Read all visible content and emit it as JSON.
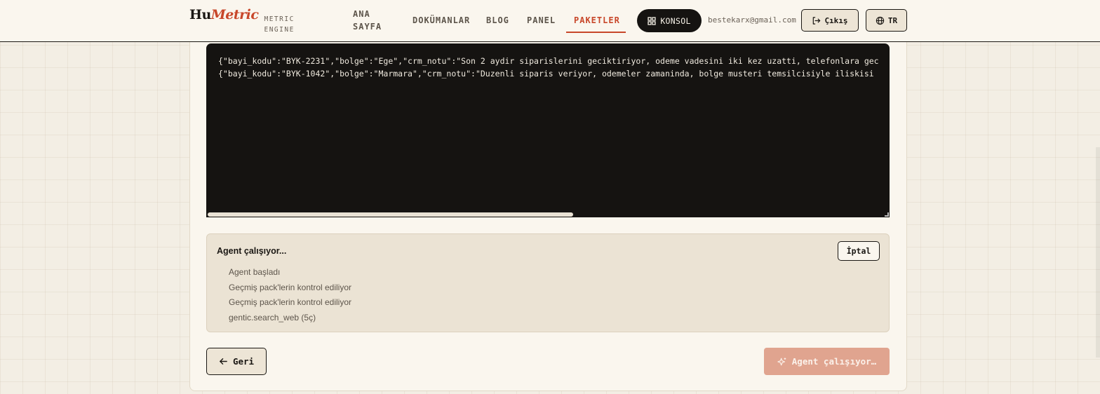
{
  "header": {
    "logo": {
      "part1": "Hu",
      "part2": "Metric",
      "subtitle_line1": "METRIC",
      "subtitle_line2": "ENGINE"
    },
    "nav": [
      {
        "label_line1": "ANA",
        "label_line2": "SAYFA"
      },
      {
        "label": "DOKÜMANLAR"
      },
      {
        "label": "BLOG"
      },
      {
        "label": "PANEL"
      },
      {
        "label": "PAKETLER",
        "active": true
      }
    ],
    "console_label": "KONSOL",
    "user_email": "bestekarx@gmail.com",
    "logout_label": "Çıkış",
    "language_label": "TR"
  },
  "editor": {
    "lines": [
      "{\"bayi_kodu\":\"BYK-2231\",\"bolge\":\"Ege\",\"crm_notu\":\"Son 2 aydir siparislerini geciktiriyor, odeme vadesini iki kez uzatti, telefonlara gec",
      "{\"bayi_kodu\":\"BYK-1042\",\"bolge\":\"Marmara\",\"crm_notu\":\"Duzenli siparis veriyor, odemeler zamaninda, bolge musteri temsilcisiyle iliskisi"
    ]
  },
  "agent_status": {
    "title": "Agent çalışıyor...",
    "cancel_label": "İptal",
    "steps": [
      "Agent başladı",
      "Geçmiş pack'lerin kontrol ediliyor",
      "Geçmiş pack'lerin kontrol ediliyor",
      "gentic.search_web (5ç)"
    ]
  },
  "footer": {
    "back_label": "Geri",
    "run_label": "Agent çalışıyor…"
  },
  "colors": {
    "accent": "#c8472a",
    "run_button": "#e0a48f",
    "code_bg": "#151311",
    "status_bg": "#ebe3d4"
  }
}
